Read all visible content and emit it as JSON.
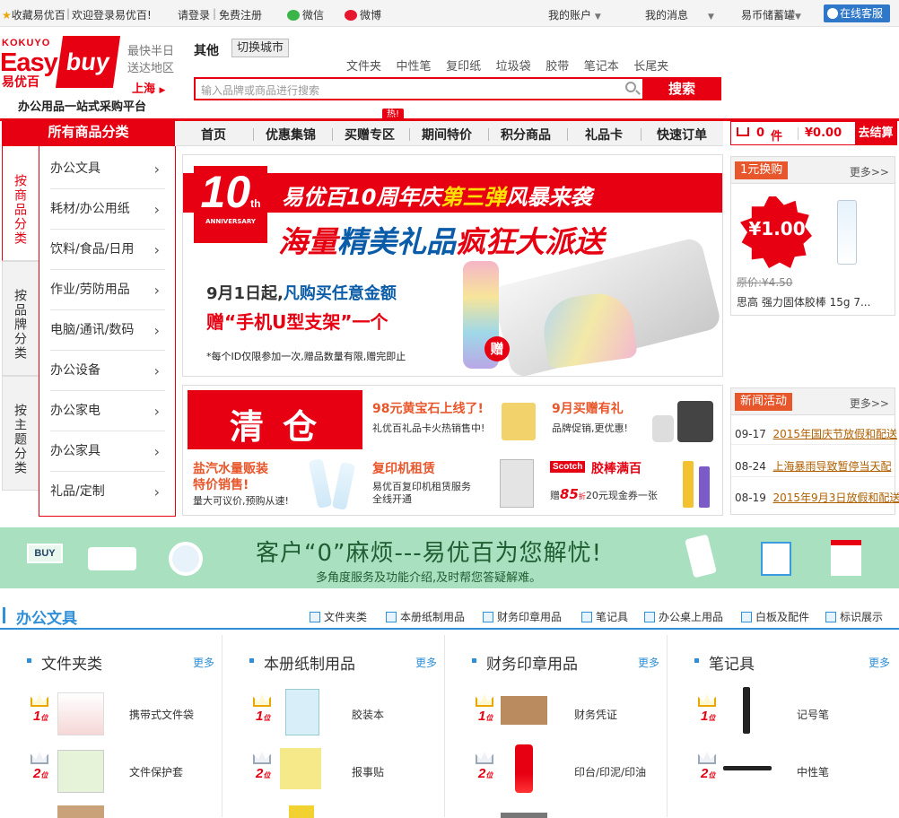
{
  "topbar": {
    "favorite": "收藏易优百",
    "welcome": "欢迎登录易优百!",
    "login": "请登录",
    "register": "免费注册",
    "wechat": "微信",
    "weibo": "微博",
    "account": "我的账户",
    "messages": "我的消息",
    "coin": "易币储蓄罐",
    "service": "在线客服"
  },
  "logo": {
    "brand_top": "KOKUYO",
    "brand_easy": "Easy",
    "brand_buy": "buy",
    "brand_cn": "易优百",
    "slogan": "办公用品一站式采购平台",
    "delivery_line1": "最快半日",
    "delivery_line2": "送达地区",
    "city": "上海"
  },
  "city_bar": {
    "current": "其他",
    "switch": "切换城市"
  },
  "search": {
    "placeholder": "输入品牌或商品进行搜索",
    "button": "搜索",
    "hot_words": [
      "文件夹",
      "中性笔",
      "复印纸",
      "垃圾袋",
      "胶带",
      "笔记本",
      "长尾夹"
    ]
  },
  "nav": {
    "all_categories": "所有商品分类",
    "items": [
      "首页",
      "优惠集锦",
      "买赠专区",
      "期间特价",
      "积分商品",
      "礼品卡",
      "快速订单"
    ],
    "hot_badge": "热!"
  },
  "cart": {
    "count": "0",
    "unit": "件",
    "total": "¥0.00",
    "checkout": "去结算"
  },
  "sidebar": {
    "tabs": [
      "按商品分类",
      "按品牌分类",
      "按主题分类"
    ],
    "categories": [
      "办公文具",
      "耗材/办公用纸",
      "饮料/食品/日用",
      "作业/劳防用品",
      "电脑/通讯/数码",
      "办公设备",
      "办公家电",
      "办公家具",
      "礼品/定制"
    ]
  },
  "banner": {
    "badge_num": "10",
    "badge_th": "th",
    "badge_text": "ANNIVERSARY",
    "headline_a": "易优百10周年庆",
    "headline_b": "第三弹",
    "headline_c": "风暴来袭",
    "sub_a": "海量",
    "sub_b": "精美礼品",
    "sub_c": "疯狂",
    "sub_d": "大派送",
    "line1_a": "9月1日起,",
    "line1_b": "凡购买任意金额",
    "line2": "赠“手机U型支架”一个",
    "note": "*每个ID仅限参加一次,赠品数量有限,赠完即止",
    "gift_tag": "赠"
  },
  "swap": {
    "tag": "1元换购",
    "more": "更多>>",
    "price_big": "¥1.00",
    "orig_price": "原价:¥4.50",
    "product": "思高 强力固体胶棒 15g 7..."
  },
  "news": {
    "tag": "新闻活动",
    "more": "更多>>",
    "items": [
      {
        "date": "09-17",
        "title": "2015年国庆节放假和配送"
      },
      {
        "date": "08-24",
        "title": "上海暴雨导致暂停当天配"
      },
      {
        "date": "08-19",
        "title": "2015年9月3日放假和配送"
      }
    ]
  },
  "tiles": {
    "clearance": "清 仓",
    "gold_title": "98元黄宝石上线了!",
    "gold_sub": "礼优百礼品卡火热销售中!",
    "sept_title": "9月买赠有礼",
    "sept_sub": "品牌促销,更优惠!",
    "water_title1": "盐汽水量贩装",
    "water_title2": "特价销售!",
    "water_sub": "量大可议价,预购从速!",
    "copier_title": "复印机租赁",
    "copier_sub1": "易优百复印机租赁服务",
    "copier_sub2": "全线开通",
    "scotch_brand": "Scotch",
    "scotch_title": "胶棒满百",
    "scotch_sub_a": "赠",
    "scotch_sub_b": "85",
    "scotch_sub_c": "折",
    "scotch_sub_d": "20元现金券一张"
  },
  "service": {
    "title": "客户“0”麻烦---易优百为您解忧!",
    "sub": "多角度服务及功能介绍,及时帮您答疑解难。",
    "buy_tag": "BUY"
  },
  "office": {
    "title": "办公文具",
    "links": [
      "文件夹类",
      "本册纸制用品",
      "财务印章用品",
      "笔记具",
      "办公桌上用品",
      "白板及配件",
      "标识展示"
    ],
    "columns": [
      {
        "title": "文件夹类",
        "more": "更多",
        "products": [
          "携带式文件袋",
          "文件保护套"
        ]
      },
      {
        "title": "本册纸制用品",
        "more": "更多",
        "products": [
          "胶装本",
          "报事贴"
        ]
      },
      {
        "title": "财务印章用品",
        "more": "更多",
        "products": [
          "财务凭证",
          "印台/印泥/印油"
        ]
      },
      {
        "title": "笔记具",
        "more": "更多",
        "products": [
          "记号笔",
          "中性笔"
        ]
      }
    ],
    "rank_labels": [
      "1",
      "2"
    ],
    "rank_suffix": "位"
  },
  "colors": {
    "brand_red": "#e60012",
    "accent_blue": "#2f8fd8",
    "service_green": "#a9e0bf"
  }
}
